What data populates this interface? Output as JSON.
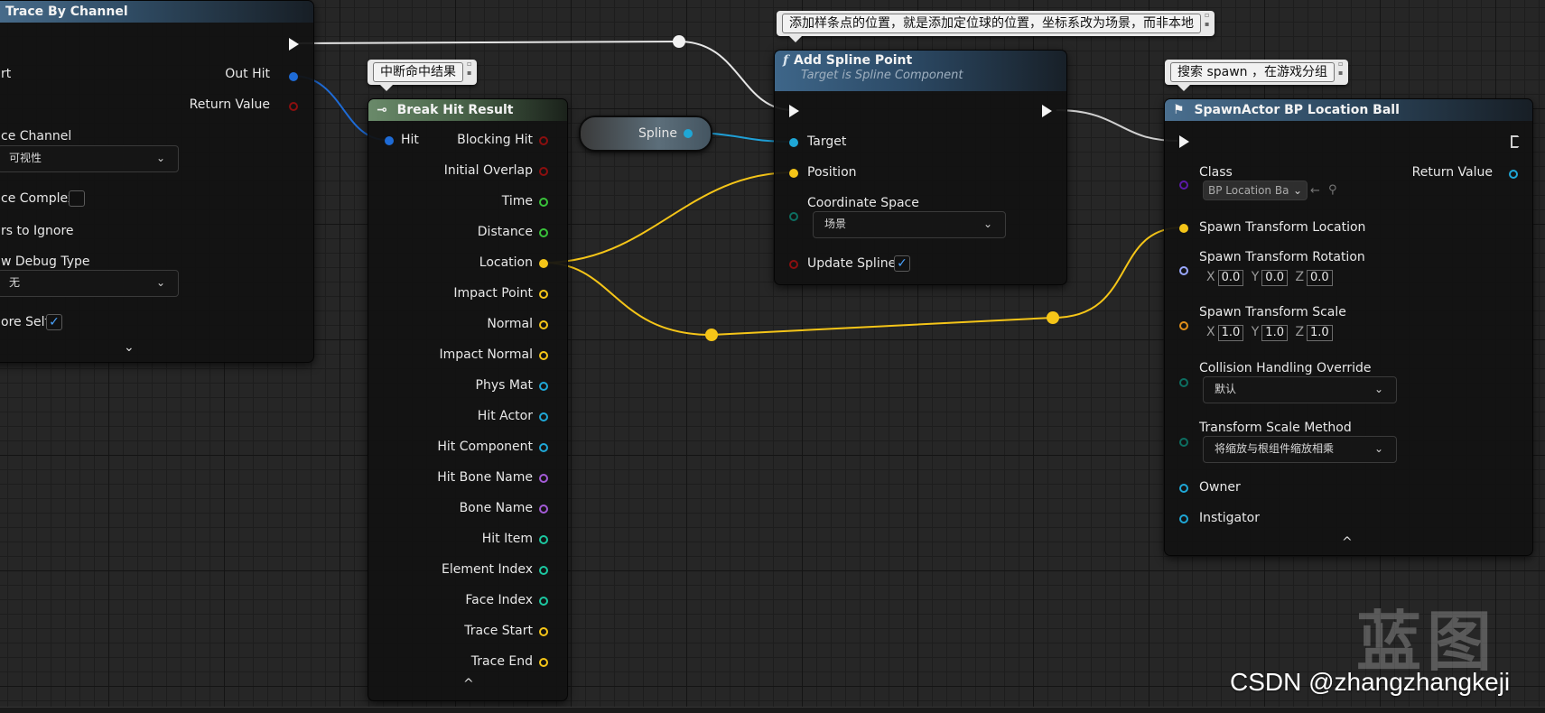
{
  "colors": {
    "exec": "#f4f4f4",
    "struct": "#1e6bd6",
    "bool": "#8b0f0f",
    "float": "#39c23a",
    "vector": "#f5c518",
    "object": "#1fa7d6",
    "name": "#a35bd6",
    "int": "#1cc7a0",
    "rotator": "#9aa8ff",
    "enum": "#0d6e61",
    "class": "#5b1aa8",
    "transform": "#e08f1a",
    "wire_data_blue": "#1f9fd6",
    "wire_vector": "#f5c518"
  },
  "trace_node": {
    "title": "Trace By Channel",
    "out_hit": "Out Hit",
    "return_value": "Return Value",
    "row_start": "rt",
    "trace_channel": "ce Channel",
    "trace_channel_value": "可视性",
    "trace_complex": "ce Complex",
    "actors_ignore": "rs to Ignore",
    "draw_debug": "w Debug Type",
    "draw_debug_value": "无",
    "ignore_self": "ore Self",
    "collapse": "⌄"
  },
  "break_node": {
    "comment": "中断命中结果",
    "title": "Break Hit Result",
    "hit": "Hit",
    "outputs": [
      {
        "label": "Blocking Hit",
        "type": "bool"
      },
      {
        "label": "Initial Overlap",
        "type": "bool"
      },
      {
        "label": "Time",
        "type": "float"
      },
      {
        "label": "Distance",
        "type": "float"
      },
      {
        "label": "Location",
        "type": "vector"
      },
      {
        "label": "Impact Point",
        "type": "vector"
      },
      {
        "label": "Normal",
        "type": "vector"
      },
      {
        "label": "Impact Normal",
        "type": "vector"
      },
      {
        "label": "Phys Mat",
        "type": "object"
      },
      {
        "label": "Hit Actor",
        "type": "object"
      },
      {
        "label": "Hit Component",
        "type": "object"
      },
      {
        "label": "Hit Bone Name",
        "type": "name"
      },
      {
        "label": "Bone Name",
        "type": "name"
      },
      {
        "label": "Hit Item",
        "type": "int"
      },
      {
        "label": "Element Index",
        "type": "int"
      },
      {
        "label": "Face Index",
        "type": "int"
      },
      {
        "label": "Trace Start",
        "type": "vector"
      },
      {
        "label": "Trace End",
        "type": "vector"
      }
    ],
    "collapse": "^"
  },
  "spline_var": {
    "label": "Spline"
  },
  "add_spline": {
    "comment": "添加样条点的位置，就是添加定位球的位置，坐标系改为场景，而非本地",
    "title": "Add Spline Point",
    "subtitle": "Target is Spline Component",
    "fn_icon": "f",
    "target": "Target",
    "position": "Position",
    "coord_space": "Coordinate Space",
    "coord_space_value": "场景",
    "update_spline": "Update Spline"
  },
  "spawn": {
    "comment": "搜索 spawn ，在游戏分组",
    "title": "SpawnActor BP Location Ball",
    "class": "Class",
    "class_value": "BP Location Ba",
    "return_value": "Return Value",
    "spawn_loc": "Spawn Transform Location",
    "spawn_rot": "Spawn Transform Rotation",
    "rot": {
      "x": "0.0",
      "y": "0.0",
      "z": "0.0"
    },
    "spawn_scale": "Spawn Transform Scale",
    "scale": {
      "x": "1.0",
      "y": "1.0",
      "z": "1.0"
    },
    "axis_x": "X",
    "axis_y": "Y",
    "axis_z": "Z",
    "collision": "Collision Handling Override",
    "collision_value": "默认",
    "scale_method": "Transform Scale Method",
    "scale_method_value": "将缩放与根组件缩放相乘",
    "owner": "Owner",
    "instigator": "Instigator",
    "collapse": "^"
  },
  "watermark": {
    "logo": "蓝图",
    "text": "CSDN @zhangzhangkeji"
  }
}
